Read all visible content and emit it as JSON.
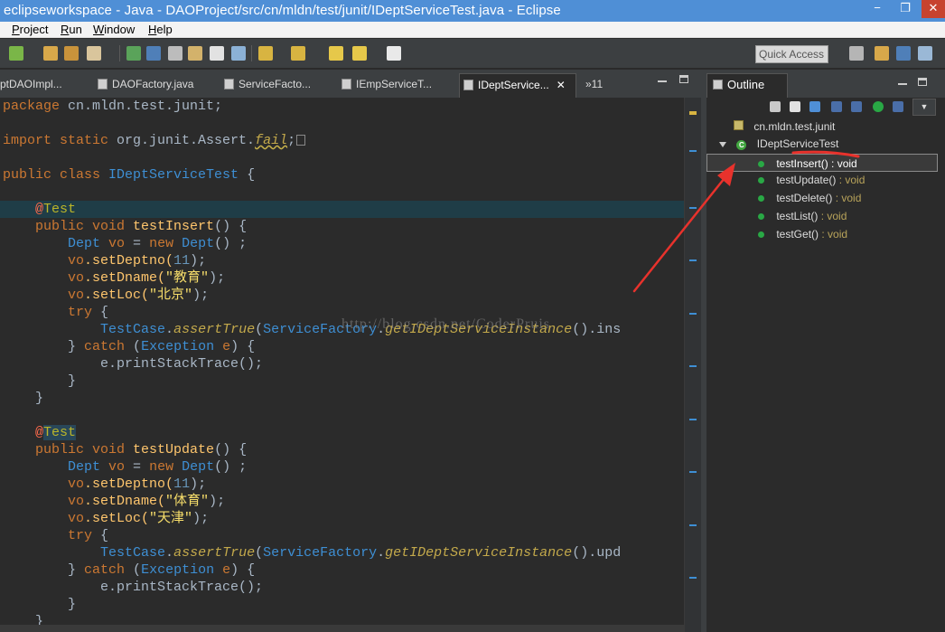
{
  "window": {
    "title": "eclipseworkspace - Java - DAOProject/src/cn/mldn/test/junit/IDeptServiceTest.java - Eclipse",
    "min": "−",
    "max": "❐",
    "close": "✕"
  },
  "menu": {
    "items": [
      {
        "u": "P",
        "rest": "roject"
      },
      {
        "u": "R",
        "rest": "un"
      },
      {
        "u": "W",
        "rest": "indow"
      },
      {
        "u": "H",
        "rest": "elp"
      }
    ]
  },
  "toolbar": {
    "quick_access": "Quick Access"
  },
  "editor_tabs": [
    {
      "label": "ptDAOImpl..."
    },
    {
      "label": "DAOFactory.java"
    },
    {
      "label": "ServiceFacto..."
    },
    {
      "label": "IEmpServiceT..."
    },
    {
      "label": "IDeptService...",
      "close": "✕"
    },
    {
      "label": "»11"
    }
  ],
  "code": {
    "l1": {
      "kw": "package",
      "rest": " cn.mldn.test.junit;"
    },
    "l2": {
      "kw": "import static",
      "rest": " org.junit.Assert.",
      "fn": "fail",
      "end": ";"
    },
    "l3": {
      "kw": "public class",
      "name": " IDeptServiceTest",
      "end": " {"
    },
    "l4": {
      "at": "@",
      "ann": "Test"
    },
    "l5": {
      "kw": "public void",
      "fn": " testInsert",
      "end": "() {"
    },
    "l6": {
      "ty": "Dept",
      "v": " vo",
      "eq": " = ",
      "kw": "new",
      "ty2": " Dept",
      "end": "() ;"
    },
    "l7": {
      "a": "vo",
      "b": ".setDeptno(",
      "n": "11",
      "c": ");"
    },
    "l8": {
      "a": "vo",
      "b": ".setDname(",
      "s": "\"教育\"",
      "c": ");"
    },
    "l9": {
      "a": "vo",
      "b": ".setLoc(",
      "s": "\"北京\"",
      "c": ");"
    },
    "l10": {
      "kw": "try",
      "end": " {"
    },
    "l11": {
      "ty": "TestCase",
      "dot": ".",
      "it": "assertTrue",
      "p": "(",
      "ty2": "ServiceFactory",
      "dot2": ".",
      "it2": "getIDeptServiceInstance",
      "end": "().ins"
    },
    "l12": {
      "b1": "} ",
      "kw": "catch",
      "p": " (",
      "ty": "Exception",
      "v": " e",
      "end": ") {"
    },
    "l13": {
      "text": "e.printStackTrace();"
    },
    "l14": {
      "text": "}"
    },
    "l15": {
      "text": "}"
    },
    "l16": {
      "at": "@",
      "ann": "Test"
    },
    "l17": {
      "kw": "public void",
      "fn": " testUpdate",
      "end": "() {"
    },
    "l18": {
      "ty": "Dept",
      "v": " vo",
      "eq": " = ",
      "kw": "new",
      "ty2": " Dept",
      "end": "() ;"
    },
    "l19": {
      "a": "vo",
      "b": ".setDeptno(",
      "n": "11",
      "c": ");"
    },
    "l20": {
      "a": "vo",
      "b": ".setDname(",
      "s": "\"体育\"",
      "c": ");"
    },
    "l21": {
      "a": "vo",
      "b": ".setLoc(",
      "s": "\"天津\"",
      "c": ");"
    },
    "l22": {
      "kw": "try",
      "end": " {"
    },
    "l23": {
      "ty": "TestCase",
      "dot": ".",
      "it": "assertTrue",
      "p": "(",
      "ty2": "ServiceFactory",
      "dot2": ".",
      "it2": "getIDeptServiceInstance",
      "end": "().upd"
    },
    "l24": {
      "b1": "} ",
      "kw": "catch",
      "p": " (",
      "ty": "Exception",
      "v": " e",
      "end": ") {"
    },
    "l25": {
      "text": "e.printStackTrace();"
    },
    "l26": {
      "text": "}"
    },
    "l27": {
      "text": "}"
    }
  },
  "watermark": "http://blog.csdn.net/CoderPruis",
  "outline": {
    "tab": "Outline",
    "package": "cn.mldn.test.junit",
    "class": "IDeptServiceTest",
    "class_icon": "C",
    "methods": [
      {
        "name": "testInsert()",
        "ret": " : void"
      },
      {
        "name": "testUpdate()",
        "ret": " : void"
      },
      {
        "name": "testDelete()",
        "ret": " : void"
      },
      {
        "name": "testList()",
        "ret": " : void"
      },
      {
        "name": "testGet()",
        "ret": " : void"
      }
    ]
  },
  "colors": {
    "titlebar": "#4f8fd6",
    "editor_bg": "#2b2b2b",
    "keyword": "#cc7832",
    "type": "#3e8fd4",
    "method": "#ffc66d",
    "arrow": "#e8322c"
  }
}
